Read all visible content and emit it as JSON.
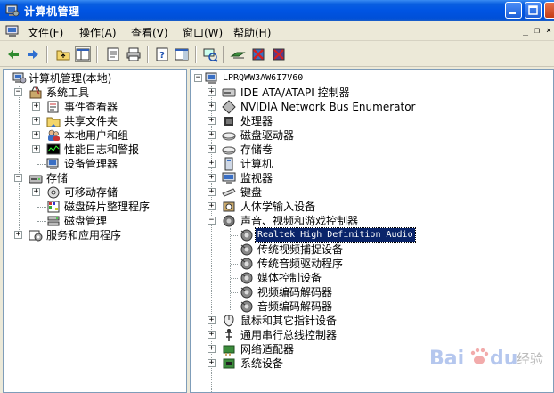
{
  "window": {
    "title": "计算机管理"
  },
  "menu": [
    "文件(F)",
    "操作(A)",
    "查看(V)",
    "窗口(W)",
    "帮助(H)"
  ],
  "left_tree": {
    "root": "计算机管理(本地)",
    "items": [
      {
        "label": "系统工具"
      },
      {
        "label": "事件查看器"
      },
      {
        "label": "共享文件夹"
      },
      {
        "label": "本地用户和组"
      },
      {
        "label": "性能日志和警报"
      },
      {
        "label": "设备管理器"
      },
      {
        "label": "存储"
      },
      {
        "label": "可移动存储"
      },
      {
        "label": "磁盘碎片整理程序"
      },
      {
        "label": "磁盘管理"
      },
      {
        "label": "服务和应用程序"
      }
    ]
  },
  "device_tree": {
    "computer": "LPRQWW3AW6I7V60",
    "items": [
      "IDE ATA/ATAPI 控制器",
      "NVIDIA Network Bus Enumerator",
      "处理器",
      "磁盘驱动器",
      "存储卷",
      "计算机",
      "监视器",
      "键盘",
      "人体学输入设备",
      "声音、视频和游戏控制器",
      "Realtek High Definition Audio",
      "传统视频捕捉设备",
      "传统音频驱动程序",
      "媒体控制设备",
      "视频编码解码器",
      "音频编码解码器",
      "鼠标和其它指针设备",
      "通用串行总线控制器",
      "网络适配器",
      "系统设备"
    ]
  },
  "watermark": {
    "brand": "Bai",
    "brand2": "经验",
    "colors": {
      "blue": "#2a5ecf",
      "red": "#de2d2d"
    }
  },
  "colors": {
    "titlebar": "#0054e3",
    "selection": "#0a246a",
    "arrow": "#e53a2a"
  }
}
